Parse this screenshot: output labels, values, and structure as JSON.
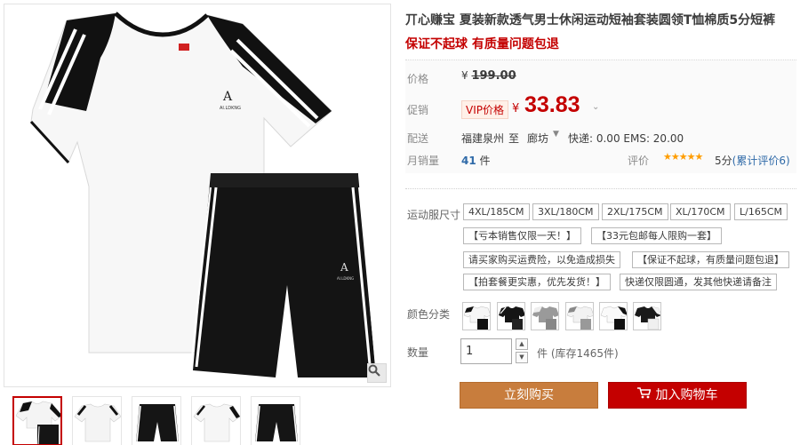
{
  "product": {
    "title": "丌心赚宝 夏装新款透气男士休闲运动短袖套装圆领T恤棉质5分短裤",
    "subtitle": "保证不起球 有质量问题包退"
  },
  "price": {
    "label_original": "价格",
    "currency": "¥",
    "original": "199.00",
    "label_promo": "促销",
    "vip_tag": "VIP价格",
    "promo": "33.83"
  },
  "shipping": {
    "label": "配送",
    "from": "福建泉州",
    "to_word": "至",
    "destination": "廊坊",
    "cost": "快递: 0.00 EMS: 20.00"
  },
  "sales": {
    "label": "月销量",
    "count": "41",
    "unit": "件",
    "rating_label": "评价",
    "stars": "★★★★★",
    "rating_score": "5分",
    "review_link": "(累计评价6)"
  },
  "options": {
    "size_label": "运动服尺寸",
    "sizes": [
      "4XL/185CM",
      "3XL/180CM",
      "2XL/175CM",
      "XL/170CM",
      "L/165CM"
    ],
    "notes": [
      "【亏本销售仅限一天！】",
      "【33元包邮每人限购一套】",
      "请买家购买运费险，以免造成损失",
      "【保证不起球，有质量问题包退】",
      "【拍套餐更实惠，优先发货！】",
      "快递仅限圆通，发其他快递请备注"
    ],
    "color_label": "颜色分类",
    "colors": [
      "白配黑",
      "黑配白",
      "灰配白",
      "白配灰",
      "白配黑短裤",
      "黑配白短裤"
    ]
  },
  "quantity": {
    "label": "数量",
    "value": "1",
    "stock": "件 (库存1465件)"
  },
  "actions": {
    "buy_now": "立刻购买",
    "add_cart": "加入购物车"
  },
  "colors": {
    "accent": "#c40000",
    "buy_button": "#c87d3d",
    "link": "#2f6aa8",
    "stars": "#ff9d00"
  },
  "icons": {
    "zoom": "magnifier-icon",
    "cart": "shopping-cart-icon"
  }
}
